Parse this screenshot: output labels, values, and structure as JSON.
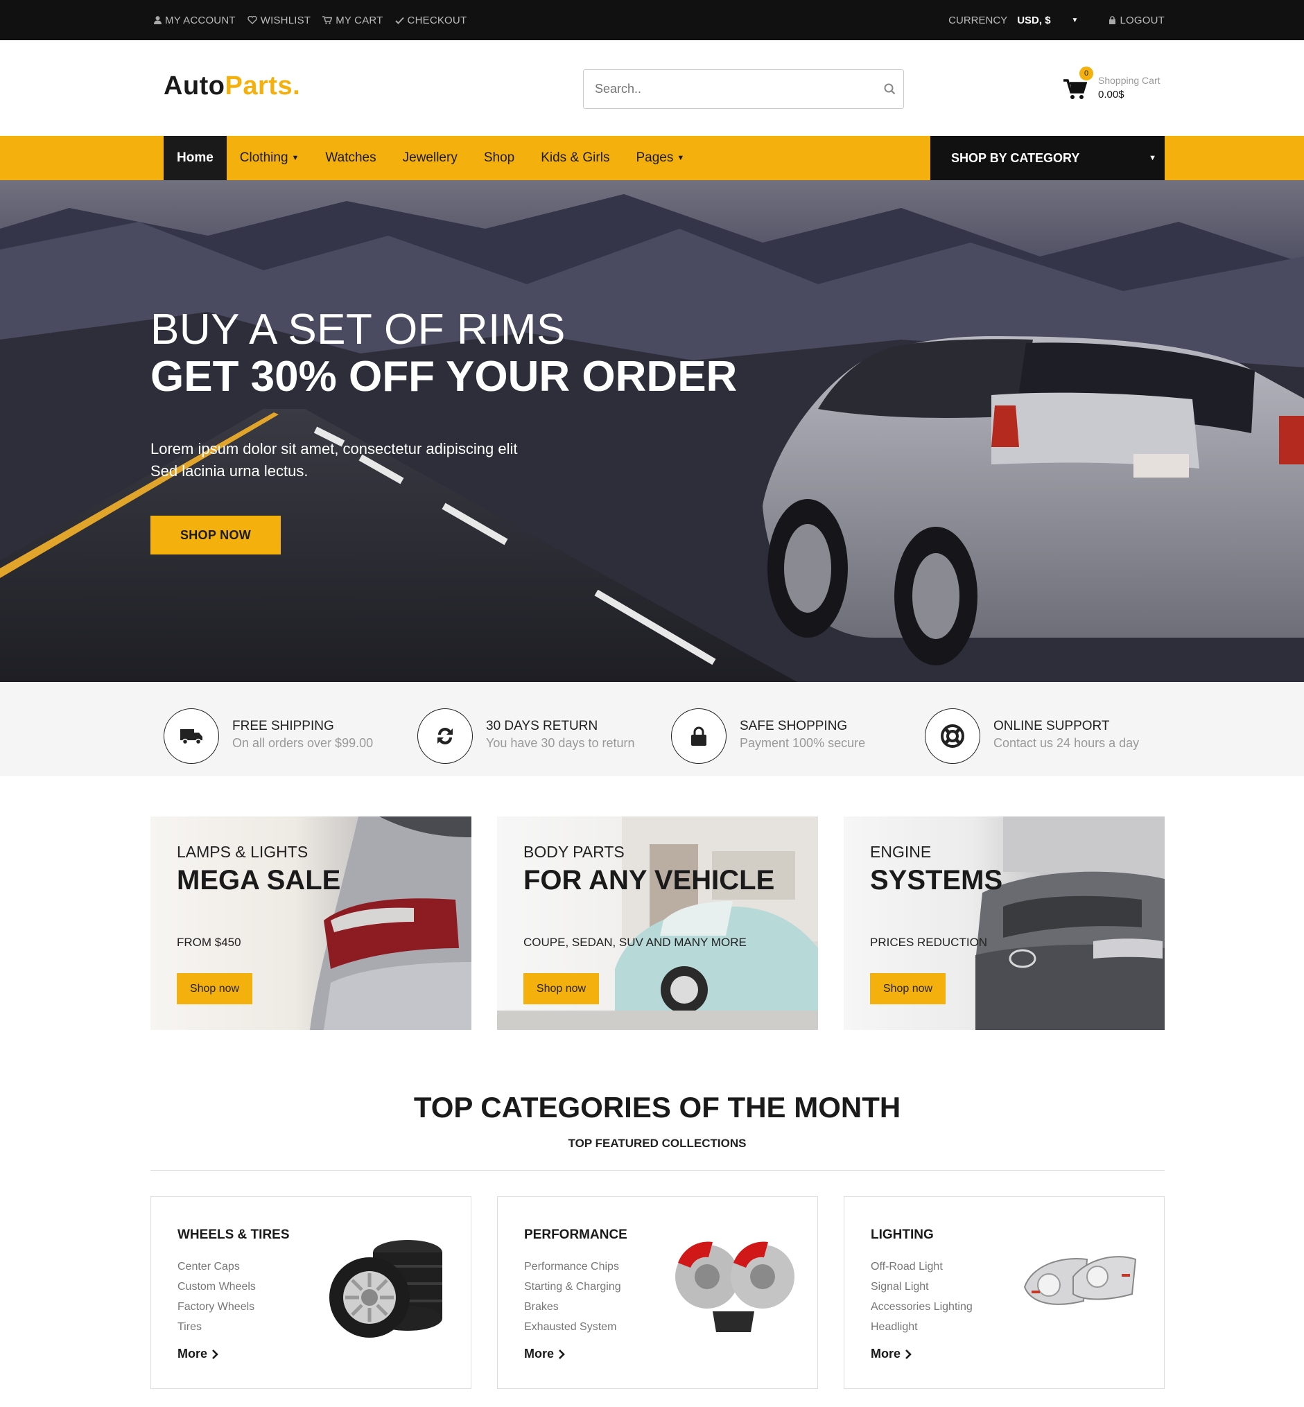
{
  "topbar": {
    "my_account": "MY ACCOUNT",
    "wishlist": "WISHLIST",
    "my_cart": "MY CART",
    "checkout": "CHECKOUT",
    "currency_label": "CURRENCY",
    "currency_value": "USD, $",
    "logout": "LOGOUT"
  },
  "header": {
    "logo_part1": "Auto",
    "logo_part2": "Parts.",
    "search_placeholder": "Search..",
    "cart_count": "0",
    "cart_label": "Shopping Cart",
    "cart_total": "0.00$"
  },
  "nav": {
    "items": [
      {
        "label": "Home"
      },
      {
        "label": "Clothing"
      },
      {
        "label": "Watches"
      },
      {
        "label": "Jewellery"
      },
      {
        "label": "Shop"
      },
      {
        "label": "Kids & Girls"
      },
      {
        "label": "Pages"
      }
    ],
    "category_button": "SHOP BY CATEGORY"
  },
  "hero": {
    "line1": "BUY A SET OF RIMS",
    "line2": "GET 30% OFF YOUR ORDER",
    "text1": "Lorem ipsum dolor sit amet, consectetur adipiscing elit",
    "text2": "Sed lacinia urna lectus.",
    "button": "SHOP NOW"
  },
  "features": [
    {
      "title": "FREE SHIPPING",
      "sub": "On all orders over $99.00",
      "icon": "truck-icon"
    },
    {
      "title": "30 DAYS RETURN",
      "sub": "You have 30 days to return",
      "icon": "refresh-icon"
    },
    {
      "title": "SAFE SHOPPING",
      "sub": "Payment 100% secure",
      "icon": "lock-icon"
    },
    {
      "title": "ONLINE SUPPORT",
      "sub": "Contact us 24 hours a day",
      "icon": "lifebuoy-icon"
    }
  ],
  "banners": [
    {
      "kicker": "LAMPS & LIGHTS",
      "title": "MEGA SALE",
      "sub": "FROM $450",
      "button": "Shop now"
    },
    {
      "kicker": "BODY PARTS",
      "title": "FOR ANY VEHICLE",
      "sub": "COUPE, SEDAN, SUV AND MANY MORE",
      "button": "Shop now"
    },
    {
      "kicker": "ENGINE",
      "title": "SYSTEMS",
      "sub": "PRICES REDUCTION",
      "button": "Shop now"
    }
  ],
  "section": {
    "title": "TOP CATEGORIES OF THE MONTH",
    "subtitle": "TOP FEATURED COLLECTIONS"
  },
  "categories": [
    {
      "title": "WHEELS & TIRES",
      "links": [
        "Center Caps",
        "Custom Wheels",
        "Factory Wheels",
        "Tires"
      ],
      "more": "More"
    },
    {
      "title": "PERFORMANCE",
      "links": [
        "Performance Chips",
        "Starting & Charging",
        "Brakes",
        "Exhausted System"
      ],
      "more": "More"
    },
    {
      "title": "LIGHTING",
      "links": [
        "Off-Road Light",
        "Signal Light",
        "Accessories Lighting",
        "Headlight"
      ],
      "more": "More"
    }
  ],
  "colors": {
    "accent": "#f4b10d",
    "dark": "#111111"
  }
}
